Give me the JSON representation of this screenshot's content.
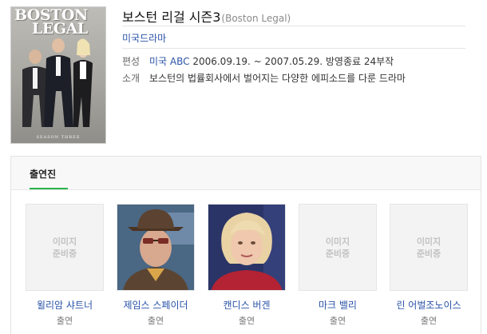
{
  "poster": {
    "logo_line1": "BOSTON",
    "logo_line2": "LEGAL",
    "season": "SEASON THREE"
  },
  "title": "보스턴 리걸 시즌3",
  "title_en": "(Boston Legal)",
  "genre": "미국드라마",
  "info": {
    "broadcast_label": "편성",
    "broadcast_link": "미국 ABC",
    "broadcast_text": " 2006.09.19. ~ 2007.05.29. 방영종료 24부작",
    "summary_label": "소개",
    "summary_text": "보스턴의 법률회사에서 벌어지는 다양한 에피소드를 다룬 드라마"
  },
  "cast": {
    "tab_label": "출연진",
    "placeholder_line1": "이미지",
    "placeholder_line2": "준비중",
    "people": [
      {
        "name": "윌리암 샤트너",
        "role": "출연"
      },
      {
        "name": "제임스 스페이더",
        "role": "출연"
      },
      {
        "name": "캔디스 버겐",
        "role": "출연"
      },
      {
        "name": "마크 밸리",
        "role": "출연"
      },
      {
        "name": "린 어벌조노이스",
        "role": "출연"
      }
    ]
  }
}
